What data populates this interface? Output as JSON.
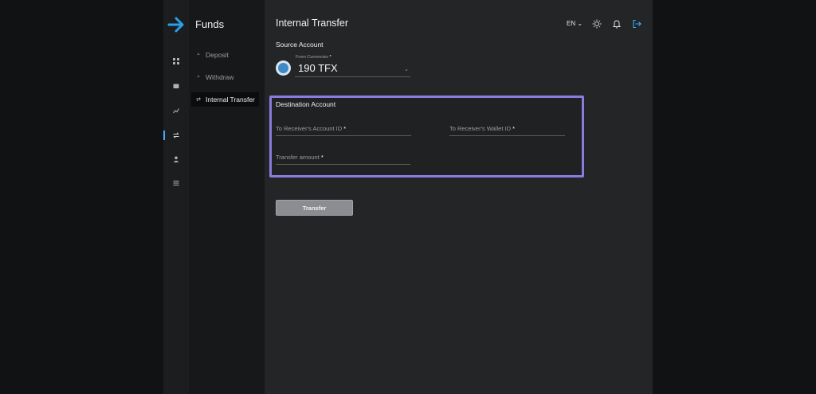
{
  "brand": {
    "title": "Funds",
    "logo_icon": "arrow-right-icon",
    "accent": "#2a9fe6"
  },
  "rail": {
    "icons": [
      "dashboard-icon",
      "wallet-icon",
      "chart-icon",
      "transfer-icon",
      "user-icon",
      "list-icon"
    ],
    "active_index": 3
  },
  "nav": {
    "items": [
      {
        "label": "Deposit",
        "icon": "deposit-icon"
      },
      {
        "label": "Withdraw",
        "icon": "withdraw-icon"
      },
      {
        "label": "Internal Transfer",
        "icon": "swap-icon",
        "active": true
      }
    ]
  },
  "header": {
    "title": "Internal Transfer",
    "lang": "EN",
    "icons": [
      "theme-sun-icon",
      "bell-icon",
      "logout-icon"
    ]
  },
  "source": {
    "section_label": "Source Account",
    "from_label": "From Currencies",
    "required_mark": "*",
    "value": "190 TFX",
    "coin_icon": "tfx-coin-icon"
  },
  "destination": {
    "section_label": "Destination Account",
    "highlight_color": "#8c7ae0",
    "fields": {
      "receiver_account_id": "To Receiver's Account ID",
      "receiver_wallet_id": "To Receiver's Wallet ID",
      "transfer_amount": "Transfer amount"
    },
    "required_mark": "*"
  },
  "actions": {
    "transfer_label": "Transfer"
  }
}
